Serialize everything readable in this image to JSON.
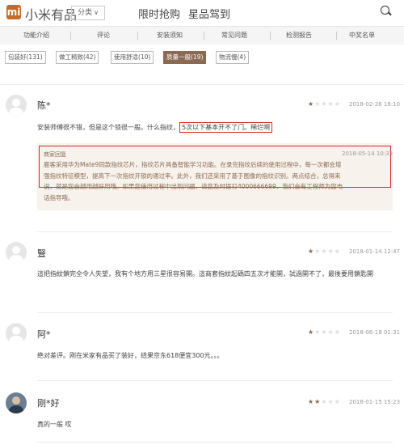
{
  "header": {
    "logo_glyph": "mi",
    "brand": "小米有品",
    "category_label": "分类",
    "nav": [
      "限时抢购",
      "星品驾到"
    ]
  },
  "tabs": [
    "功能介绍",
    "评论",
    "安装须知",
    "常见问题",
    "检测报告",
    "中奖名单"
  ],
  "filters": [
    {
      "label": "包装好(131)",
      "active": false
    },
    {
      "label": "做工精致(42)",
      "active": false
    },
    {
      "label": "使用舒适(10)",
      "active": false
    },
    {
      "label": "质量一般(19)",
      "active": true
    },
    {
      "label": "物流慢(4)",
      "active": false
    }
  ],
  "reviews": [
    {
      "user": "陈*",
      "rating": 1,
      "date": "2018-02-26 16:10",
      "text_before": "安装师傅很不错，但是这个锁很一般。什么指纹，",
      "text_highlight": "5次以下基本开不了门。稀烂啊"
    },
    {
      "user": "豎",
      "rating": 1,
      "date": "2018-01-14 12:47",
      "text": "這把指紋鎖完全令人失望，我有个地方用三星很容易開。這商套指紋起碼四五次才能開，試過開不了，最後要用鎖匙開"
    },
    {
      "user": "阿*",
      "rating": 1,
      "date": "2018-06-18 01:31",
      "text": "绝对差评。刚在米家有品买了装好，结果京东618便宜300元。。。"
    },
    {
      "user": "刚*好",
      "rating": 2,
      "date": "2018-01-15 15:23",
      "text": "真的一般 哎"
    }
  ],
  "merchant_reply": {
    "label": "商家回复",
    "date": "2018-05-14 10:33",
    "line1": "鹿客采用华为Mate9同款指纹芯片，指纹芯片具备智能学习功能。在录完指纹后续的使用过程中，每一次都会增",
    "line2": "强指纹特征模型，提高下一次指纹开锁的通过率。此外，我们还采用了基于图像的指纹识别。两点结合，总得来",
    "line3": "说，就是您会越用越好用哦。如果您使用过程中出现问题，请您及时拨打4000666699，我们会有工程师为您电",
    "line4": "话指导哦。"
  },
  "colors": {
    "accent": "#8a6a52",
    "highlight_border": "#d42a2a",
    "logo": "#c66a28"
  }
}
